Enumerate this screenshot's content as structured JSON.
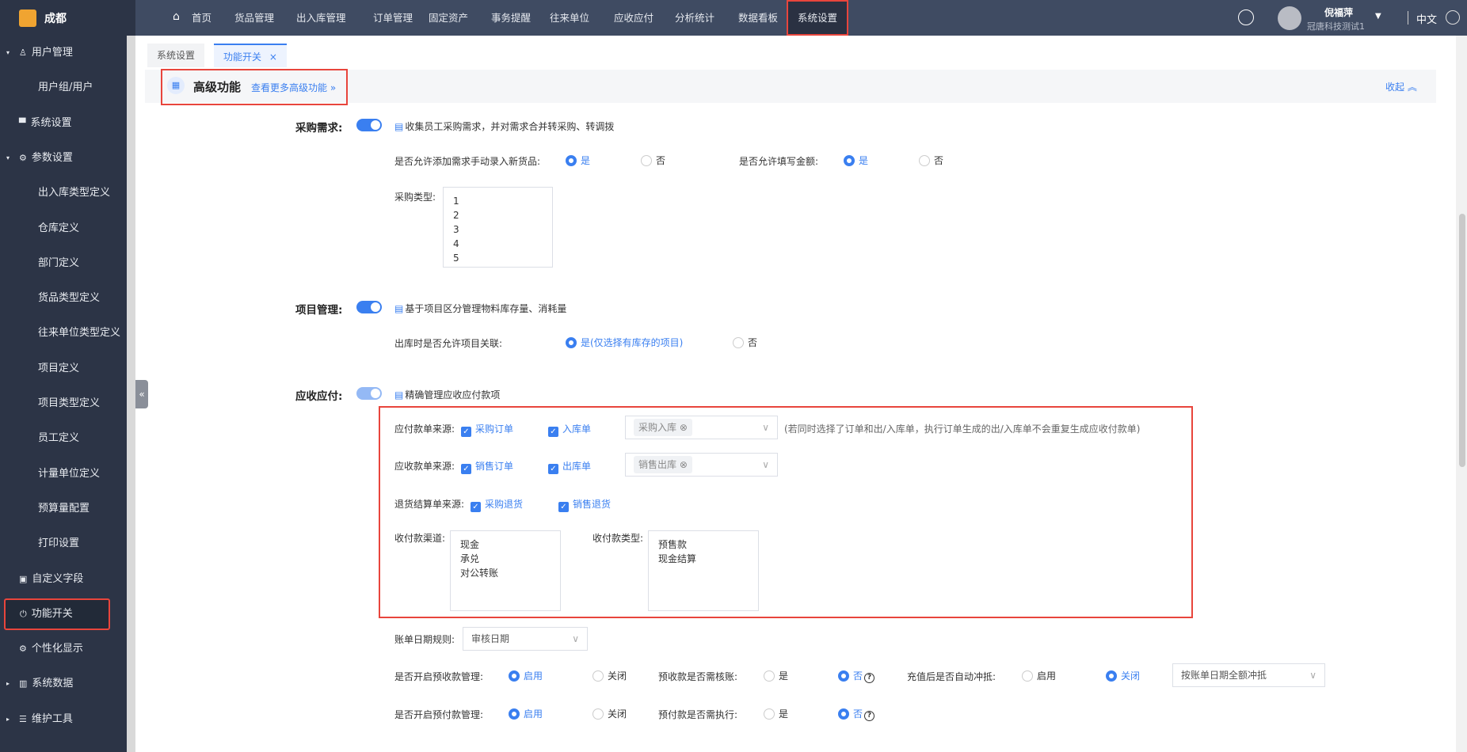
{
  "app": {
    "logo_text": "成都",
    "nav": [
      "首页",
      "货品管理",
      "出入库管理",
      "订单管理",
      "固定资产",
      "事务提醒",
      "往来单位",
      "应收应付",
      "分析统计",
      "数据看板",
      "系统设置"
    ],
    "active_nav": "系统设置",
    "user_name": "倪福萍",
    "company": "冠唐科技测试1",
    "language": "中文"
  },
  "sidebar": {
    "items": [
      "用户管理",
      "用户组/用户",
      "系统设置",
      "参数设置",
      "出入库类型定义",
      "仓库定义",
      "部门定义",
      "货品类型定义",
      "往来单位类型定义",
      "项目定义",
      "项目类型定义",
      "员工定义",
      "计量单位定义",
      "预算量配置",
      "打印设置",
      "自定义字段",
      "功能开关",
      "个性化显示",
      "系统数据",
      "维护工具"
    ]
  },
  "tabs": [
    {
      "label": "系统设置"
    },
    {
      "label": "功能开关",
      "close": "×"
    }
  ],
  "section": {
    "title": "高级功能",
    "more_link": "查看更多高级功能 »",
    "collapse": "收起 ︽"
  },
  "purchase": {
    "label": "采购需求:",
    "desc": "收集员工采购需求，并对需求合并转采购、转调拨",
    "q1": "是否允许添加需求手动录入新货品:",
    "q2": "是否允许填写金额:",
    "yes": "是",
    "no": "否",
    "types_label": "采购类型:",
    "types": [
      "1",
      "2",
      "3",
      "4",
      "5"
    ]
  },
  "project": {
    "label": "项目管理:",
    "desc": "基于项目区分管理物料库存量、消耗量",
    "q": "出库时是否允许项目关联:",
    "yes": "是(仅选择有库存的项目)",
    "no": "否"
  },
  "ar": {
    "label": "应收应付:",
    "desc": "精确管理应收应付款项",
    "pay_src": "应付款单来源:",
    "pay_opts": [
      "采购订单",
      "入库单"
    ],
    "pay_tag": "采购入库",
    "note": "(若同时选择了订单和出/入库单，执行订单生成的出/入库单不会重复生成应收付款单)",
    "recv_src": "应收款单来源:",
    "recv_opts": [
      "销售订单",
      "出库单"
    ],
    "recv_tag": "销售出库",
    "ret_src": "退货结算单来源:",
    "ret_opts": [
      "采购退货",
      "销售退货"
    ],
    "channel_label": "收付款渠道:",
    "channels": [
      "现金",
      "承兑",
      "对公转账"
    ],
    "type_label": "收付款类型:",
    "types": [
      "预售款",
      "现金结算"
    ],
    "date_rule_label": "账单日期规则:",
    "date_rule": "审核日期",
    "pre_recv": "是否开启预收款管理:",
    "enable": "启用",
    "close": "关闭",
    "pre_recv_verify": "预收款是否需核账:",
    "yes": "是",
    "no": "否",
    "recharge": "充值后是否自动冲抵:",
    "recharge_sel": "按账单日期全额冲抵",
    "pre_pay": "是否开启预付款管理:",
    "pre_pay_exec": "预付款是否需执行:"
  }
}
